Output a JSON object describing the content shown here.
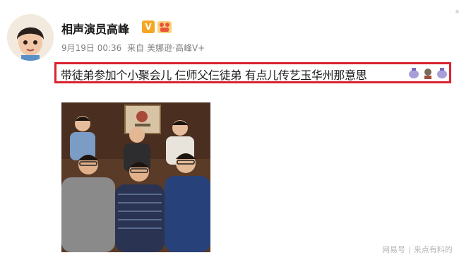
{
  "post": {
    "author": "相声演员高峰",
    "verified_badge": "V",
    "date": "9月19日 00:36",
    "source_prefix": "来自",
    "source": "美娜逊·高峰V+",
    "text": "带徒弟参加个小聚会儿 仨师父仨徒弟 有点儿传艺玉华州那意思"
  },
  "watermark": {
    "site": "网易号",
    "account": "来点有料的"
  },
  "colors": {
    "highlight_border": "#d9232f",
    "badge": "#f5a623"
  }
}
